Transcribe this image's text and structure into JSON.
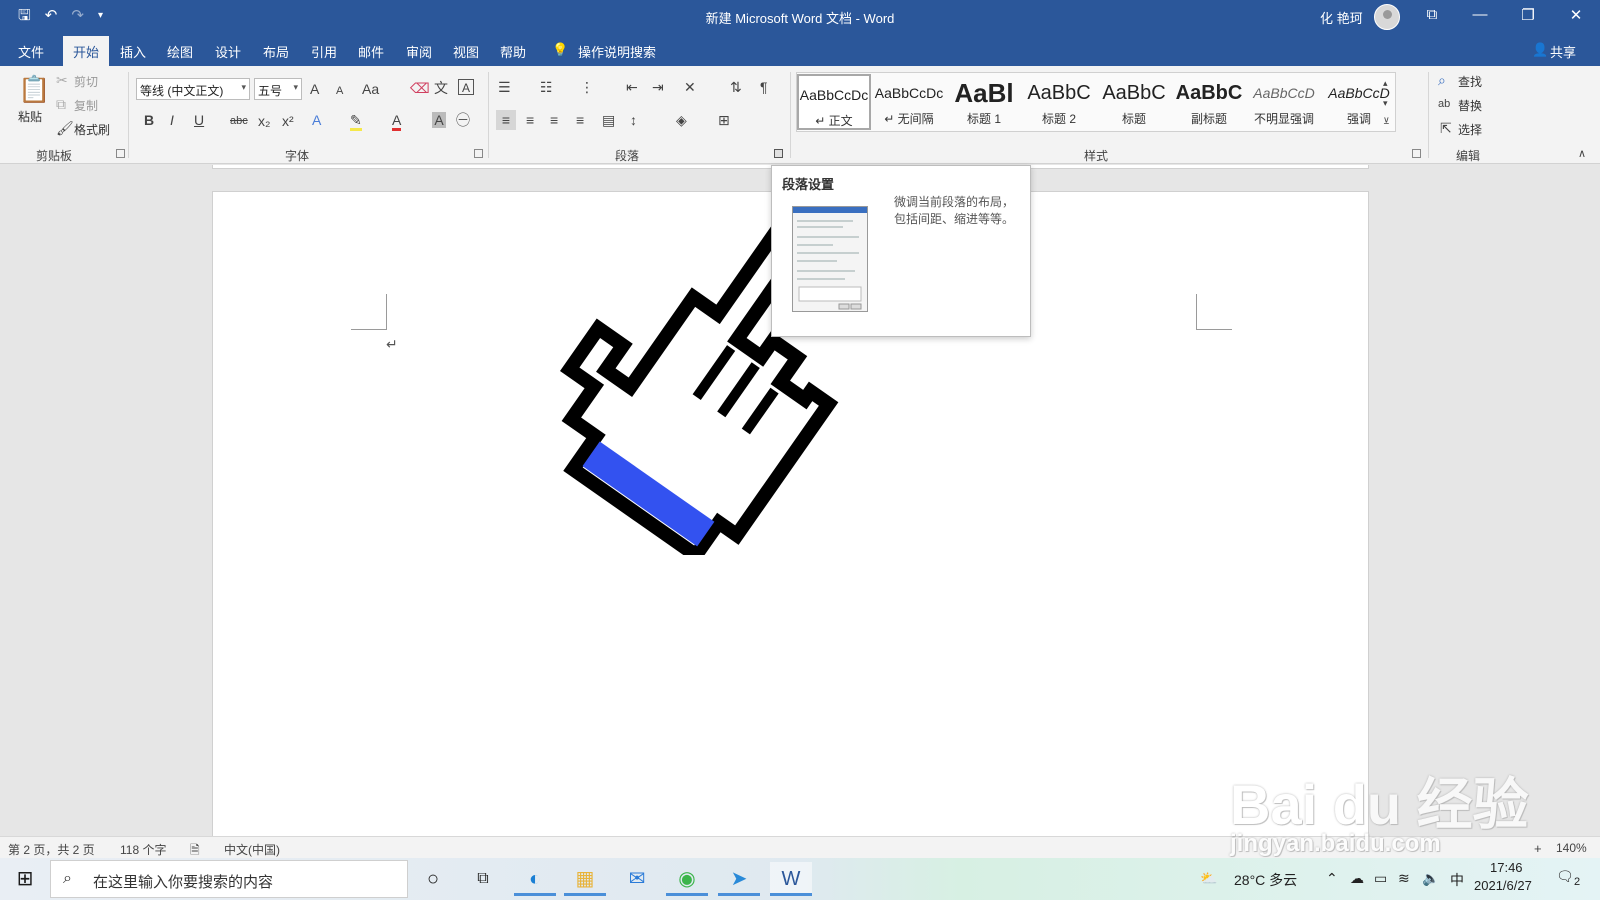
{
  "window": {
    "title": "新建 Microsoft Word 文档 - Word",
    "user": "化 艳珂",
    "controls": [
      "⧉",
      "—",
      "❐",
      "✕"
    ]
  },
  "tabs": {
    "items": [
      "文件",
      "开始",
      "插入",
      "绘图",
      "设计",
      "布局",
      "引用",
      "邮件",
      "审阅",
      "视图",
      "帮助"
    ],
    "search_hint": "操作说明搜索",
    "share": "共享"
  },
  "clipboard": {
    "paste": "粘贴",
    "cut": "剪切",
    "copy": "复制",
    "format_painter": "格式刷",
    "group": "剪贴板"
  },
  "font": {
    "name": "等线 (中文正文)",
    "size": "五号",
    "group": "字体",
    "buttons": [
      "A",
      "A",
      "Aa",
      "B",
      "I",
      "U",
      "abc",
      "x₂",
      "x²"
    ]
  },
  "paragraph": {
    "group": "段落"
  },
  "styles": {
    "group": "样式",
    "items": [
      {
        "sample": "AaBbCcDc",
        "name": "↵ 正文"
      },
      {
        "sample": "AaBbCcDc",
        "name": "↵ 无间隔"
      },
      {
        "sample": "AaBl",
        "name": "标题 1"
      },
      {
        "sample": "AaBbC",
        "name": "标题 2"
      },
      {
        "sample": "AaBbC",
        "name": "标题"
      },
      {
        "sample": "AaBbC",
        "name": "副标题"
      },
      {
        "sample": "AaBbCcD",
        "name": "不明显强调"
      },
      {
        "sample": "AaBbCcD",
        "name": "强调"
      }
    ]
  },
  "editing": {
    "find": "查找",
    "replace": "替换",
    "select": "选择",
    "group": "编辑"
  },
  "tooltip": {
    "title": "段落设置",
    "description": "微调当前段落的布局，包括间距、缩进等等。"
  },
  "document": {
    "paragraph_mark": "↵"
  },
  "status": {
    "page": "第 2 页，共 2 页",
    "words": "118 个字",
    "language": "中文(中国)",
    "zoom": "140%"
  },
  "taskbar": {
    "search_placeholder": "在这里输入你要搜索的内容",
    "weather": "28°C 多云",
    "ime": "中",
    "time": "17:46",
    "date": "2021/6/27",
    "notifications": "2"
  },
  "watermark": {
    "brand": "Bai du 经验",
    "url": "jingyan.baidu.com"
  },
  "colors": {
    "word_blue": "#2b579a",
    "cursor_fill": "#3352f0"
  }
}
